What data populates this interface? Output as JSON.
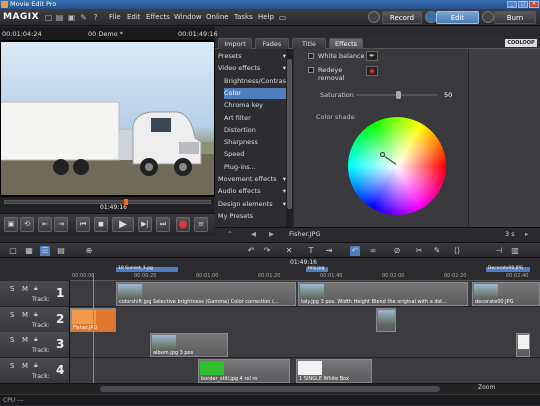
{
  "window": {
    "title": "Movie Edit Pro",
    "btn_min": "_",
    "btn_max": "□",
    "btn_close": "✕"
  },
  "menubar": {
    "logo": "MAGIX",
    "items": [
      "File",
      "Edit",
      "Effects",
      "Window",
      "Online",
      "Tasks",
      "Help"
    ],
    "modes": {
      "record": "Record",
      "edit": "Edit",
      "burn": "Burn"
    }
  },
  "preview": {
    "time_left": "00:01:04:24",
    "project": "00 Demo *",
    "time_right": "00:01:49:16",
    "current_time": "01:49:16"
  },
  "effects": {
    "tabs": [
      "Import",
      "Fades",
      "Title",
      "Effects"
    ],
    "active_tab": "Effects",
    "brand": "COOLOOP",
    "list": [
      {
        "label": "Presets",
        "arrow": "▾",
        "sub": false,
        "selected": false
      },
      {
        "label": "Video effects",
        "arrow": "▾",
        "sub": false,
        "selected": false
      },
      {
        "label": "Brightness/Contrast",
        "arrow": "",
        "sub": true,
        "selected": false
      },
      {
        "label": "Color",
        "arrow": "",
        "sub": true,
        "selected": true
      },
      {
        "label": "Chroma key",
        "arrow": "",
        "sub": true,
        "selected": false
      },
      {
        "label": "Art filter",
        "arrow": "",
        "sub": true,
        "selected": false
      },
      {
        "label": "Distortion",
        "arrow": "",
        "sub": true,
        "selected": false
      },
      {
        "label": "Sharpness",
        "arrow": "",
        "sub": true,
        "selected": false
      },
      {
        "label": "Speed",
        "arrow": "",
        "sub": true,
        "selected": false
      },
      {
        "label": "Plug-ins...",
        "arrow": "",
        "sub": true,
        "selected": false
      },
      {
        "label": "Movement effects",
        "arrow": "▾",
        "sub": false,
        "selected": false
      },
      {
        "label": "Audio effects",
        "arrow": "▾",
        "sub": false,
        "selected": false
      },
      {
        "label": "Design elements",
        "arrow": "▾",
        "sub": false,
        "selected": false
      },
      {
        "label": "My Presets",
        "arrow": "",
        "sub": false,
        "selected": false
      }
    ],
    "white_balance": "White balance",
    "redeye": "Redeye removal",
    "saturation_label": "Saturation",
    "saturation_value": "50",
    "saturation_level": 0.5,
    "color_shade_label": "Color shade",
    "bottom_file": "Fisher.JPG",
    "bottom_duration": "3 s"
  },
  "timeline": {
    "ruler_time": "01:49:16",
    "ruler_marks": [
      "00:00:00",
      "00:00:20",
      "00:01:00",
      "00:01:20",
      "00:01:40",
      "00:02:00",
      "00:02:20",
      "00:02:40"
    ],
    "markers": [
      "10 Sunset_1.pg",
      "taly.jpg",
      "Decorate00.JPG"
    ],
    "tracks": [
      {
        "number": "1",
        "label": "Track:",
        "clips": [
          {
            "label": "colorshift.jpg  Selective brightness (Gamma)  Color correction (...",
            "color": "#6a6a6e"
          },
          {
            "label": "taly.jpg  3 pos.  Width  Height  Blend the original with a dst...",
            "color": "#6a6a6e"
          },
          {
            "label": "decorate00.JPG",
            "color": "#6a6a6e"
          }
        ]
      },
      {
        "number": "2",
        "label": "Track:",
        "clips": [
          {
            "label": "Fisher.JPG",
            "color": "#e0782e"
          },
          {
            "label": "",
            "color": "#6a6a6e"
          }
        ]
      },
      {
        "number": "3",
        "label": "Track:",
        "clips": [
          {
            "label": "album.jpg  3 pos",
            "color": "#6a6a6e"
          },
          {
            "label": "",
            "color": "#6a6a6e"
          }
        ]
      },
      {
        "number": "4",
        "label": "Track:",
        "clips": [
          {
            "label": "border_still.jpg  4 rel ro",
            "color": "#6a6a6e"
          },
          {
            "label": "1 SINGLE White Box",
            "color": "#6a6a6e"
          }
        ]
      }
    ],
    "track_buttons": [
      "S",
      "M"
    ],
    "zoom_label": "Zoom"
  },
  "status": {
    "text": "CPU ---"
  },
  "colors": {
    "accent": "#4e7fbc",
    "playhead": "#ff6a1a",
    "clip_orange": "#e0782e"
  }
}
